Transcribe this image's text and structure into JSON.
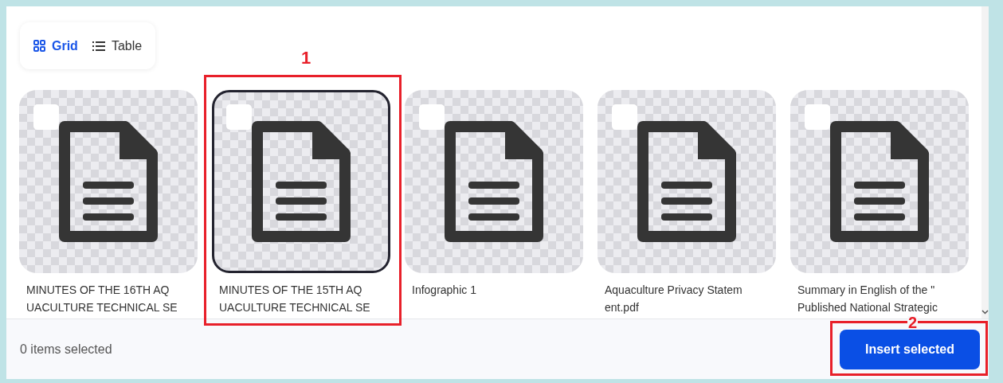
{
  "view_toggle": [
    {
      "label": "Grid",
      "kind": "grid",
      "selected": true
    },
    {
      "label": "Table",
      "kind": "table",
      "selected": false
    }
  ],
  "files": [
    {
      "name_lines": [
        "MINUTES OF THE 16TH AQ",
        "UACULTURE TECHNICAL SE"
      ],
      "checked": false,
      "focused": false
    },
    {
      "name_lines": [
        "MINUTES OF THE 15TH AQ",
        "UACULTURE TECHNICAL SE"
      ],
      "checked": false,
      "focused": true
    },
    {
      "name_lines": [
        "Infographic 1"
      ],
      "checked": false,
      "focused": false
    },
    {
      "name_lines": [
        "Aquaculture Privacy Statem",
        "ent.pdf"
      ],
      "checked": false,
      "focused": false
    },
    {
      "name_lines": [
        "Summary in English of the \"",
        "Published National Strategic"
      ],
      "checked": false,
      "focused": false
    }
  ],
  "footer": {
    "selection_count": "0 items selected",
    "insert_button": "Insert selected"
  },
  "annotations": [
    {
      "label": "1",
      "kind": "file_frame"
    },
    {
      "label": "2",
      "kind": "button_frame"
    }
  ]
}
